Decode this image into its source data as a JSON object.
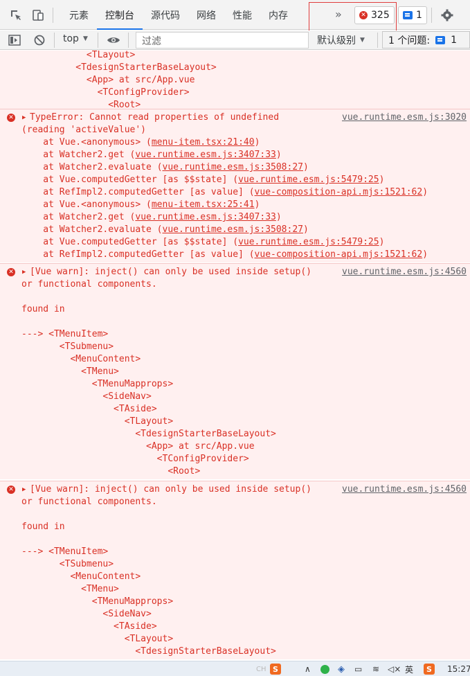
{
  "tabs": [
    {
      "label": "元素",
      "active": false
    },
    {
      "label": "控制台",
      "active": true
    },
    {
      "label": "源代码",
      "active": false
    },
    {
      "label": "网络",
      "active": false
    },
    {
      "label": "性能",
      "active": false
    },
    {
      "label": "内存",
      "active": false
    }
  ],
  "more_tabs": "»",
  "error_count": "325",
  "message_count": "1",
  "context": "top",
  "filter_placeholder": "过滤",
  "level": "默认级别",
  "issues_label": "1 个问题:",
  "issues_count": "1",
  "entries": [
    {
      "id": 0,
      "lines": [
        "            <TLayout>",
        "          <TdesignStarterBaseLayout>",
        "            <App> at src/App.vue",
        "              <TConfigProvider>",
        "                <Root>"
      ]
    },
    {
      "id": 1,
      "header": "TypeError: Cannot read properties of undefined",
      "source": "vue.runtime.esm.js:3020",
      "lines": [
        "(reading 'activeValue')",
        "    at Vue.<anonymous> (menu-item.tsx:21:40)",
        "    at Watcher2.get (vue.runtime.esm.js:3407:33)",
        "    at Watcher2.evaluate (vue.runtime.esm.js:3508:27)",
        "    at Vue.computedGetter [as $$state] (vue.runtime.esm.js:5479:25)",
        "    at RefImpl2.computedGetter [as value] (vue-composition-api.mjs:1521:62)",
        "    at Vue.<anonymous> (menu-item.tsx:25:41)",
        "    at Watcher2.get (vue.runtime.esm.js:3407:33)",
        "    at Watcher2.evaluate (vue.runtime.esm.js:3508:27)",
        "    at Vue.computedGetter [as $$state] (vue.runtime.esm.js:5479:25)",
        "    at RefImpl2.computedGetter [as value] (vue-composition-api.mjs:1521:62)"
      ]
    },
    {
      "id": 2,
      "header": "[Vue warn]: inject() can only be used inside setup()",
      "source": "vue.runtime.esm.js:4560",
      "lines": [
        "or functional components.",
        "",
        "found in",
        "",
        "---> <TMenuItem>",
        "       <TSubmenu>",
        "         <MenuContent>",
        "           <TMenu>",
        "             <TMenuMapprops>",
        "               <SideNav>",
        "                 <TAside>",
        "                   <TLayout>",
        "                     <TdesignStarterBaseLayout>",
        "                       <App> at src/App.vue",
        "                         <TConfigProvider>",
        "                           <Root>"
      ]
    },
    {
      "id": 3,
      "header": "[Vue warn]: inject() can only be used inside setup()",
      "source": "vue.runtime.esm.js:4560",
      "lines": [
        "or functional components.",
        "",
        "found in",
        "",
        "---> <TMenuItem>",
        "       <TSubmenu>",
        "         <MenuContent>",
        "           <TMenu>",
        "             <TMenuMapprops>",
        "               <SideNav>",
        "                 <TAside>",
        "                   <TLayout>",
        "                     <TdesignStarterBaseLayout>"
      ]
    }
  ],
  "taskbar": {
    "ime": "CH",
    "clock": "15:27",
    "ime_label": "英"
  },
  "colors": {
    "error_bg": "#fff0f0",
    "error_text": "#d93025",
    "accent": "#1a73e8"
  }
}
